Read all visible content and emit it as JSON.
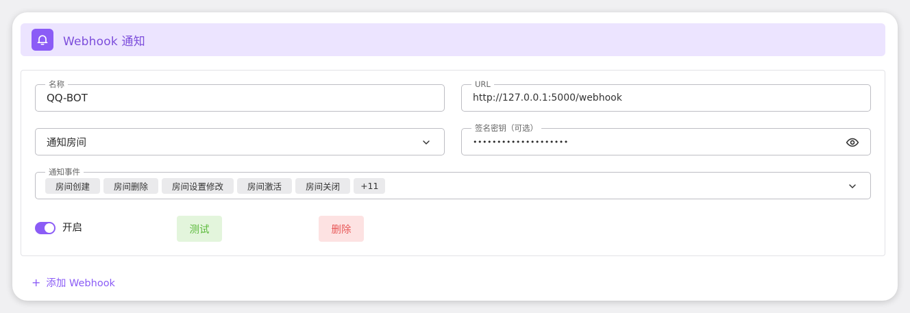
{
  "header": {
    "title": "Webhook 通知",
    "icon": "bell-icon"
  },
  "form": {
    "name": {
      "label": "名称",
      "value": "QQ-BOT"
    },
    "url": {
      "label": "URL",
      "value": "http://127.0.0.1:5000/webhook"
    },
    "room": {
      "value": "通知房间"
    },
    "secret": {
      "label": "签名密钥（可选）",
      "value": "••••••••••••••••••••"
    },
    "events": {
      "label": "通知事件",
      "chips": [
        "房间创建",
        "房间删除",
        "房间设置修改",
        "房间激活",
        "房间关闭",
        "+11"
      ]
    }
  },
  "toggle": {
    "label": "开启",
    "on": true
  },
  "buttons": {
    "test": "测试",
    "delete": "删除"
  },
  "add": {
    "label": "添加 Webhook"
  },
  "colors": {
    "accent": "#8b5cf6",
    "header_bg": "#ece4ff"
  }
}
